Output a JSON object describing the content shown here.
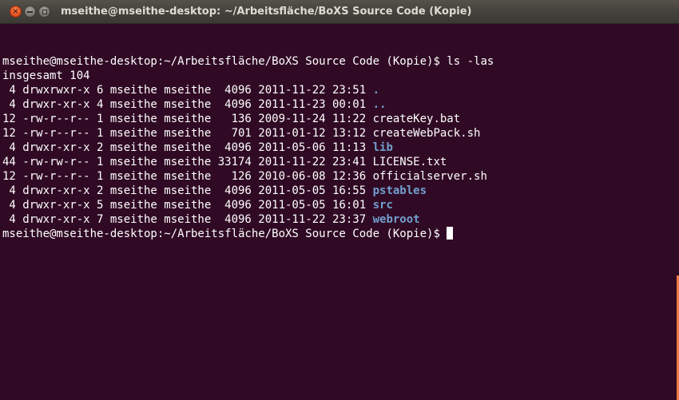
{
  "window": {
    "title": "mseithe@mseithe-desktop: ~/Arbeitsfläche/BoXS Source Code (Kopie)"
  },
  "terminal": {
    "prompt": "mseithe@mseithe-desktop:~/Arbeitsfläche/BoXS Source Code (Kopie)$ ",
    "command": "ls -las",
    "total_line": "insgesamt 104",
    "entries": [
      {
        "prefix": " 4 drwxrwxr-x 6 mseithe mseithe  4096 2011-11-22 23:51 ",
        "name": ".",
        "is_dir": true
      },
      {
        "prefix": " 4 drwxr-xr-x 4 mseithe mseithe  4096 2011-11-23 00:01 ",
        "name": "..",
        "is_dir": true
      },
      {
        "prefix": "12 -rw-r--r-- 1 mseithe mseithe   136 2009-11-24 11:22 ",
        "name": "createKey.bat",
        "is_dir": false
      },
      {
        "prefix": "12 -rw-r--r-- 1 mseithe mseithe   701 2011-01-12 13:12 ",
        "name": "createWebPack.sh",
        "is_dir": false
      },
      {
        "prefix": " 4 drwxr-xr-x 2 mseithe mseithe  4096 2011-05-06 11:13 ",
        "name": "lib",
        "is_dir": true
      },
      {
        "prefix": "44 -rw-rw-r-- 1 mseithe mseithe 33174 2011-11-22 23:41 ",
        "name": "LICENSE.txt",
        "is_dir": false
      },
      {
        "prefix": "12 -rw-r--r-- 1 mseithe mseithe   126 2010-06-08 12:36 ",
        "name": "officialserver.sh",
        "is_dir": false
      },
      {
        "prefix": " 4 drwxr-xr-x 2 mseithe mseithe  4096 2011-05-05 16:55 ",
        "name": "pstables",
        "is_dir": true
      },
      {
        "prefix": " 4 drwxr-xr-x 5 mseithe mseithe  4096 2011-05-05 16:01 ",
        "name": "src",
        "is_dir": true
      },
      {
        "prefix": " 4 drwxr-xr-x 7 mseithe mseithe  4096 2011-11-22 23:37 ",
        "name": "webroot",
        "is_dir": true
      }
    ]
  },
  "colors": {
    "terminal_bg": "#300a24",
    "directory": "#729fcf",
    "close_button": "#e5531f"
  },
  "icons": {
    "close": "close-icon",
    "minimize": "minimize-icon",
    "maximize": "maximize-icon"
  }
}
